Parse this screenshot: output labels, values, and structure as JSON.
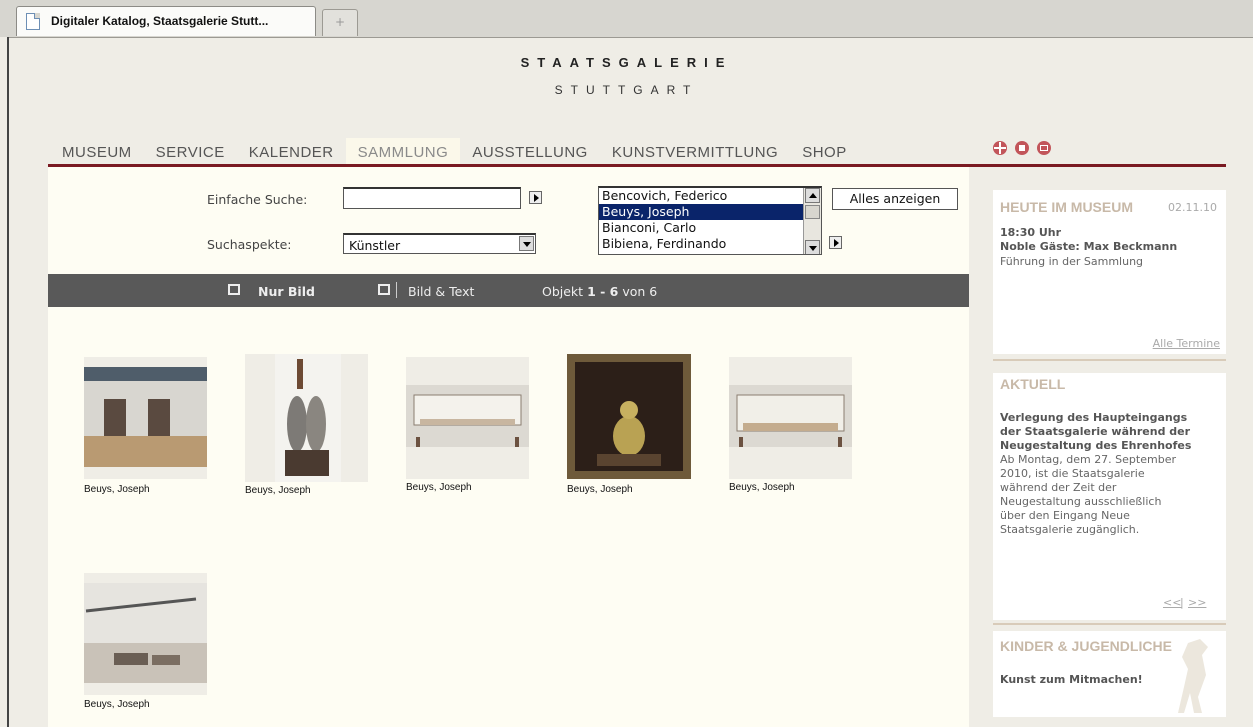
{
  "browser": {
    "tab_title": "Digitaler Katalog, Staatsgalerie Stutt...",
    "new_tab_symbol": "+"
  },
  "header": {
    "logo_line1": "STAATSGALERIE",
    "logo_line2": "STUTTGART"
  },
  "nav": {
    "items": [
      "MUSEUM",
      "SERVICE",
      "KALENDER",
      "SAMMLUNG",
      "AUSSTELLUNG",
      "KUNSTVERMITTLUNG",
      "SHOP"
    ],
    "active_index": 3,
    "icons": [
      "uk-flag-icon",
      "home-icon",
      "mail-icon"
    ],
    "accent_color": "#7a1a22"
  },
  "search": {
    "simple_label": "Einfache Suche:",
    "simple_value": "",
    "aspects_label": "Suchaspekte:",
    "aspects_selected": "Künstler",
    "artists": [
      "Bencovich, Federico",
      "Beuys, Joseph",
      "Bianconi, Carlo",
      "Bibiena, Ferdinando"
    ],
    "artists_selected_index": 1,
    "show_all_label": "Alles anzeigen"
  },
  "viewbar": {
    "image_only": "Nur Bild",
    "image_text": "Bild & Text",
    "count_prefix": "Objekt",
    "range": "1 - 6",
    "count_suffix": "von 6"
  },
  "results": [
    {
      "caption": "Beuys, Joseph"
    },
    {
      "caption": "Beuys, Joseph"
    },
    {
      "caption": "Beuys, Joseph"
    },
    {
      "caption": "Beuys, Joseph"
    },
    {
      "caption": "Beuys, Joseph"
    },
    {
      "caption": "Beuys, Joseph"
    }
  ],
  "sidebar": {
    "today": {
      "title": "HEUTE IM MUSEUM",
      "date": "02.11.10",
      "time": "18:30 Uhr",
      "event": "Noble Gäste: Max Beckmann",
      "subtitle": "Führung in der Sammlung",
      "link": "Alle Termine"
    },
    "news": {
      "title": "AKTUELL",
      "headline": [
        "Verlegung des Haupteingangs",
        "der Staatsgalerie während der",
        "Neugestaltung des Ehrenhofes"
      ],
      "body": [
        "Ab Montag, dem 27. September",
        "2010, ist die Staatsgalerie",
        "während der Zeit der",
        "Neugestaltung ausschließlich",
        "über den Eingang Neue",
        "Staatsgalerie zugänglich."
      ],
      "prev": "<<",
      "sep": "|",
      "next": ">>"
    },
    "kids": {
      "title": "KINDER & JUGENDLICHE",
      "text": "Kunst zum Mitmachen!"
    }
  }
}
